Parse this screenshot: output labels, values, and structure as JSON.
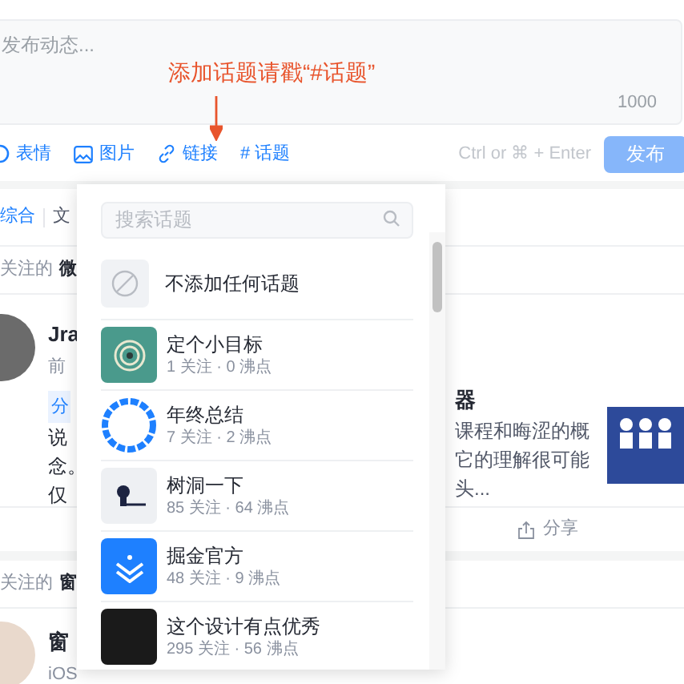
{
  "editor": {
    "placeholder": "发布动态...",
    "counter": "1000"
  },
  "annotation": "添加话题请戳“#话题”",
  "toolbar": {
    "items": [
      {
        "label": "表情",
        "kind": "emoji"
      },
      {
        "label": "图片",
        "kind": "image"
      },
      {
        "label": "链接",
        "kind": "link"
      },
      {
        "label": "# 话题",
        "kind": "topic"
      }
    ],
    "hint": "Ctrl or ⌘ + Enter",
    "publish": {
      "label": "发布",
      "disabled": true
    }
  },
  "tabs": [
    {
      "label": "综合",
      "selected": true
    },
    {
      "label": "文",
      "selected": false
    }
  ],
  "feed": [
    {
      "kind": "article",
      "source_prefix": "关注的",
      "source_name": "微",
      "author": "Jra",
      "author_title": "前",
      "tag": "分",
      "lines": [
        "说",
        "念。",
        "仅"
      ],
      "right_title": "器",
      "right_lines": [
        "课程和晦涩的概",
        "它的理解很可能",
        "头..."
      ],
      "share": "分享"
    },
    {
      "kind": "short",
      "source_prefix": "关注的",
      "source_name": "窗",
      "author": "窗",
      "author_title": "iOS"
    }
  ],
  "topic_menu": {
    "search_placeholder": "搜索话题",
    "none_label": "不添加任何话题",
    "topics": [
      {
        "name": "定个小目标",
        "meta": "1 关注 · 0 沸点",
        "kind": "target"
      },
      {
        "name": "年终总结",
        "meta": "7 关注 · 2 沸点",
        "kind": "ring"
      },
      {
        "name": "树洞一下",
        "meta": "85 关注 · 64 沸点",
        "kind": "figure"
      },
      {
        "name": "掘金官方",
        "meta": "48 关注 · 9 沸点",
        "kind": "chevrons"
      },
      {
        "name": "这个设计有点优秀",
        "meta": "295 关注 · 56 沸点",
        "kind": "dark"
      }
    ]
  }
}
